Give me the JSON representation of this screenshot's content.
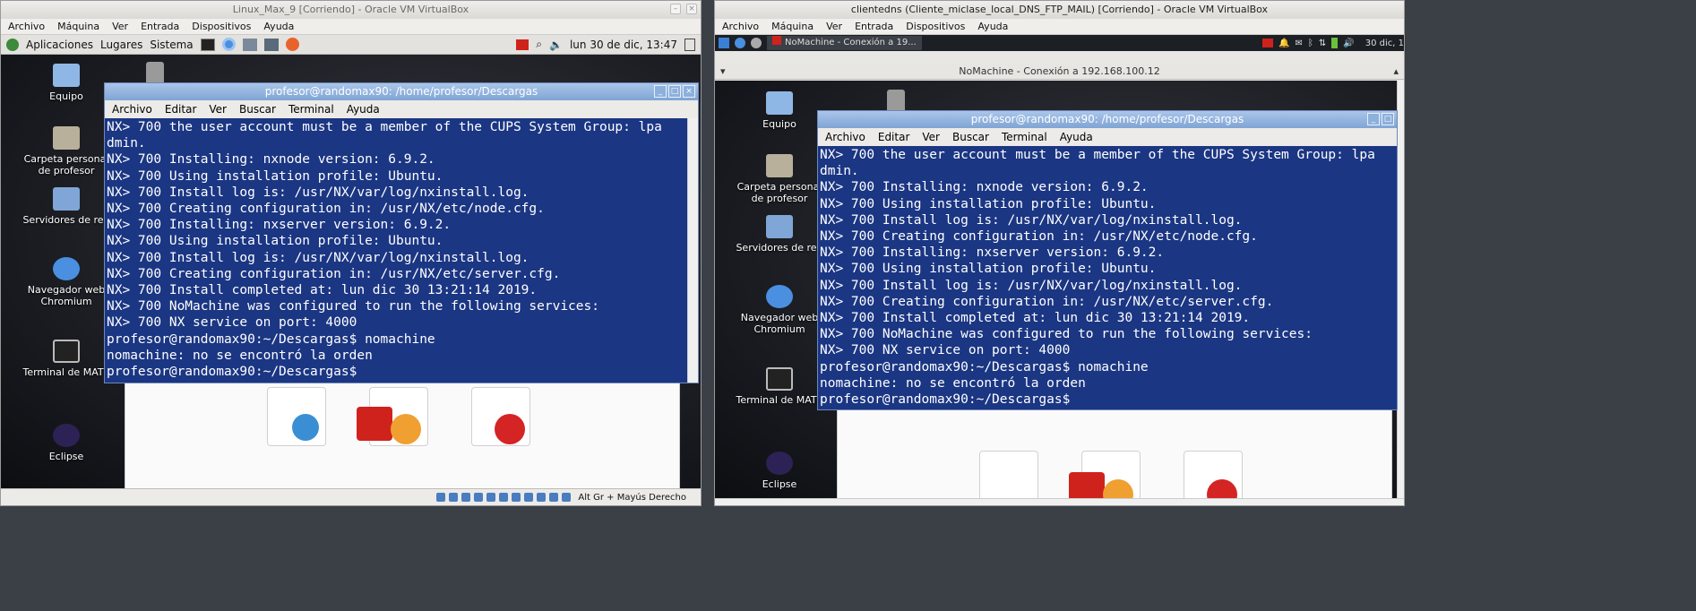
{
  "left_vm": {
    "title": "Linux_Max_9 [Corriendo] - Oracle VM VirtualBox",
    "menu": [
      "Archivo",
      "Máquina",
      "Ver",
      "Entrada",
      "Dispositivos",
      "Ayuda"
    ],
    "panel": {
      "apps": "Aplicaciones",
      "places": "Lugares",
      "system": "Sistema",
      "clock": "lun 30 de dic, 13:47"
    },
    "desktop_icons": [
      "Equipo",
      "Carpeta personal de profesor",
      "Servidores de red",
      "Navegador web Chromium",
      "Terminal de MATE",
      "Eclipse"
    ],
    "status_text": "Alt Gr + Mayús Derecho"
  },
  "right_vm": {
    "title": "clientedns (Cliente_miclase_local_DNS_FTP_MAIL) [Corriendo] - Oracle VM VirtualBox",
    "menu": [
      "Archivo",
      "Máquina",
      "Ver",
      "Entrada",
      "Dispositivos",
      "Ayuda"
    ],
    "taskbar_item": "NoMachine - Conexión a 19...",
    "clock": "30 dic, 1",
    "nomachine_title": "NoMachine - Conexión a 192.168.100.12",
    "desktop_icons": [
      "Equipo",
      "Carpeta personal de profesor",
      "Servidores de red",
      "Navegador web Chromium",
      "Terminal de MATE",
      "Eclipse"
    ]
  },
  "terminal": {
    "title": "profesor@randomax90: /home/profesor/Descargas",
    "menu": [
      "Archivo",
      "Editar",
      "Ver",
      "Buscar",
      "Terminal",
      "Ayuda"
    ],
    "lines": [
      "NX> 700 the user account must be a member of the CUPS System Group: lpa",
      "dmin.",
      "NX> 700 Installing: nxnode version: 6.9.2.",
      "NX> 700 Using installation profile: Ubuntu.",
      "NX> 700 Install log is: /usr/NX/var/log/nxinstall.log.",
      "NX> 700 Creating configuration in: /usr/NX/etc/node.cfg.",
      "NX> 700 Installing: nxserver version: 6.9.2.",
      "NX> 700 Using installation profile: Ubuntu.",
      "NX> 700 Install log is: /usr/NX/var/log/nxinstall.log.",
      "NX> 700 Creating configuration in: /usr/NX/etc/server.cfg.",
      "NX> 700 Install completed at: lun dic 30 13:21:14 2019.",
      "NX> 700 NoMachine was configured to run the following services:",
      "NX> 700 NX service on port: 4000",
      "profesor@randomax90:~/Descargas$ nomachine",
      "nomachine: no se encontró la orden",
      "profesor@randomax90:~/Descargas$"
    ]
  }
}
